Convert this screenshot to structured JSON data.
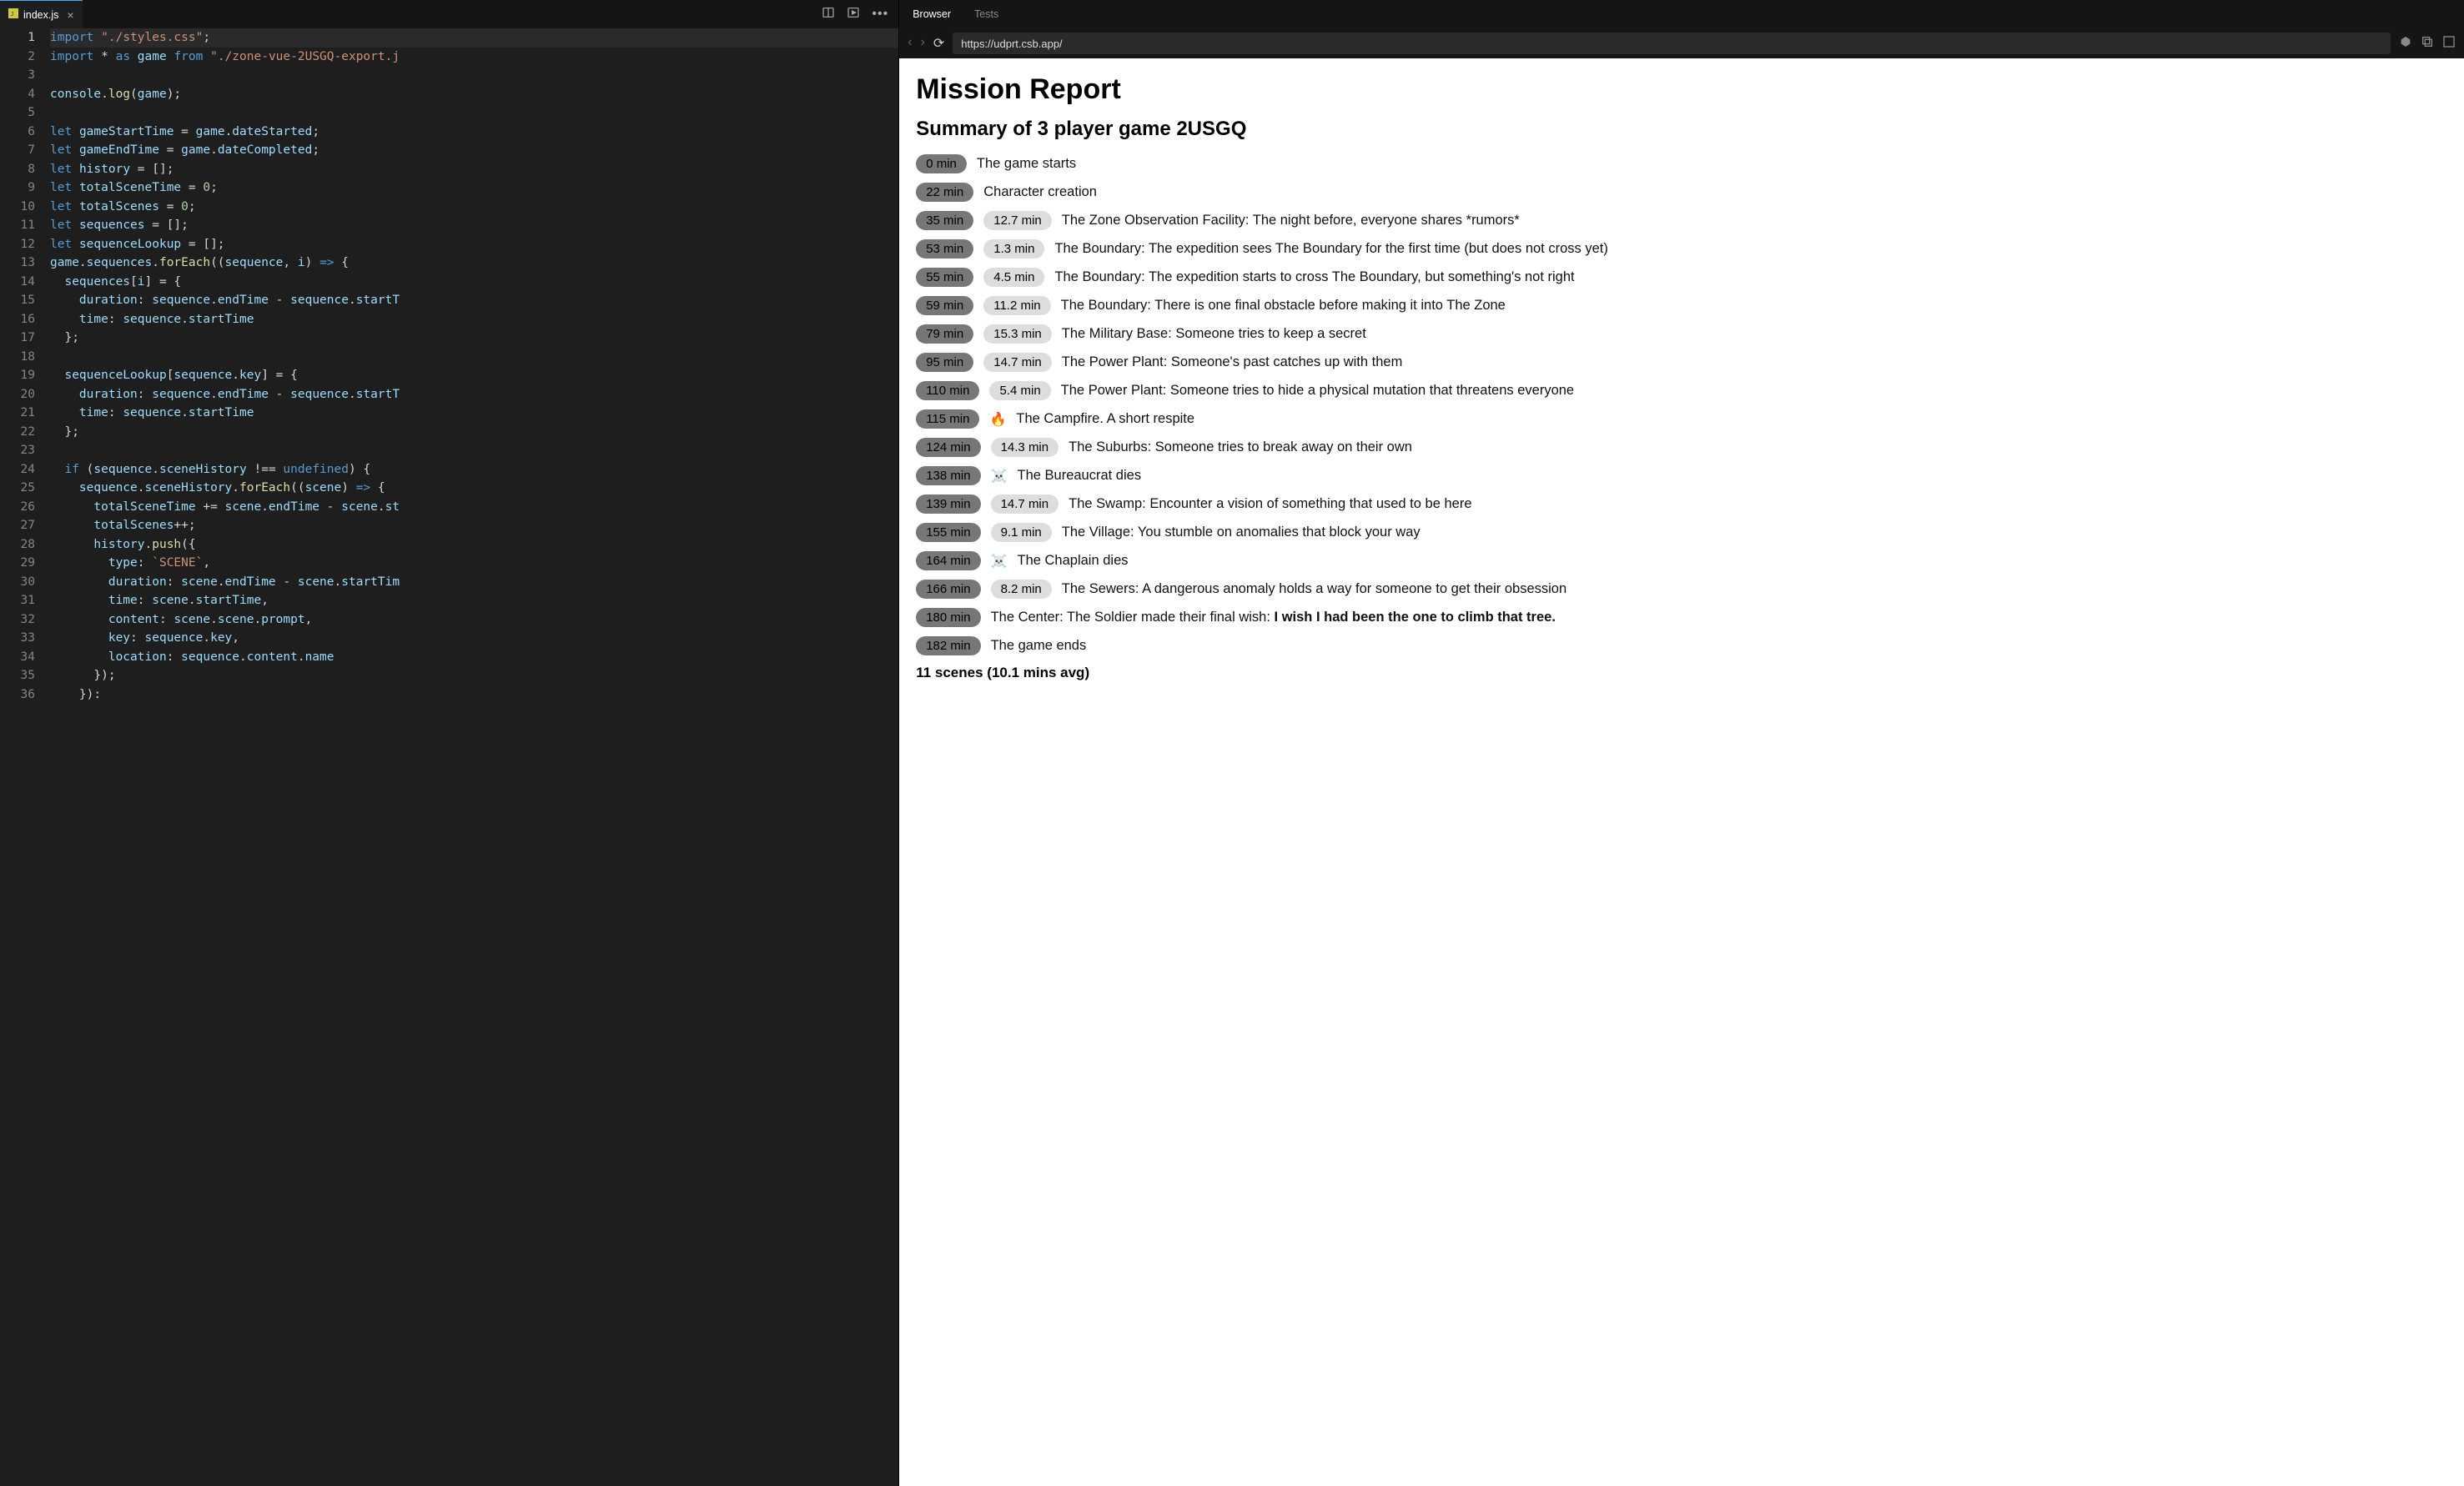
{
  "editor": {
    "tab": {
      "filename": "index.js"
    },
    "lines": [
      [
        [
          "tk-kw",
          "import"
        ],
        [
          "tk-punc",
          " "
        ],
        [
          "tk-str",
          "\"./styles.css\""
        ],
        [
          "tk-punc",
          ";"
        ]
      ],
      [
        [
          "tk-kw",
          "import"
        ],
        [
          "tk-punc",
          " "
        ],
        [
          "tk-op",
          "*"
        ],
        [
          "tk-punc",
          " "
        ],
        [
          "tk-kw",
          "as"
        ],
        [
          "tk-punc",
          " "
        ],
        [
          "tk-id",
          "game"
        ],
        [
          "tk-punc",
          " "
        ],
        [
          "tk-kw",
          "from"
        ],
        [
          "tk-punc",
          " "
        ],
        [
          "tk-str",
          "\"./zone-vue-2USGQ-export.j"
        ]
      ],
      [],
      [
        [
          "tk-id",
          "console"
        ],
        [
          "tk-punc",
          "."
        ],
        [
          "tk-fn",
          "log"
        ],
        [
          "tk-punc",
          "("
        ],
        [
          "tk-id",
          "game"
        ],
        [
          "tk-punc",
          ");"
        ]
      ],
      [],
      [
        [
          "tk-kw",
          "let"
        ],
        [
          "tk-punc",
          " "
        ],
        [
          "tk-id",
          "gameStartTime"
        ],
        [
          "tk-punc",
          " = "
        ],
        [
          "tk-id",
          "game"
        ],
        [
          "tk-punc",
          "."
        ],
        [
          "tk-prop",
          "dateStarted"
        ],
        [
          "tk-punc",
          ";"
        ]
      ],
      [
        [
          "tk-kw",
          "let"
        ],
        [
          "tk-punc",
          " "
        ],
        [
          "tk-id",
          "gameEndTime"
        ],
        [
          "tk-punc",
          " = "
        ],
        [
          "tk-id",
          "game"
        ],
        [
          "tk-punc",
          "."
        ],
        [
          "tk-prop",
          "dateCompleted"
        ],
        [
          "tk-punc",
          ";"
        ]
      ],
      [
        [
          "tk-kw",
          "let"
        ],
        [
          "tk-punc",
          " "
        ],
        [
          "tk-id",
          "history"
        ],
        [
          "tk-punc",
          " = [];"
        ]
      ],
      [
        [
          "tk-kw",
          "let"
        ],
        [
          "tk-punc",
          " "
        ],
        [
          "tk-id",
          "totalSceneTime"
        ],
        [
          "tk-punc",
          " = "
        ],
        [
          "tk-num",
          "0"
        ],
        [
          "tk-punc",
          ";"
        ]
      ],
      [
        [
          "tk-kw",
          "let"
        ],
        [
          "tk-punc",
          " "
        ],
        [
          "tk-id",
          "totalScenes"
        ],
        [
          "tk-punc",
          " = "
        ],
        [
          "tk-num",
          "0"
        ],
        [
          "tk-punc",
          ";"
        ]
      ],
      [
        [
          "tk-kw",
          "let"
        ],
        [
          "tk-punc",
          " "
        ],
        [
          "tk-id",
          "sequences"
        ],
        [
          "tk-punc",
          " = [];"
        ]
      ],
      [
        [
          "tk-kw",
          "let"
        ],
        [
          "tk-punc",
          " "
        ],
        [
          "tk-id",
          "sequenceLookup"
        ],
        [
          "tk-punc",
          " = [];"
        ]
      ],
      [
        [
          "tk-id",
          "game"
        ],
        [
          "tk-punc",
          "."
        ],
        [
          "tk-prop",
          "sequences"
        ],
        [
          "tk-punc",
          "."
        ],
        [
          "tk-fn",
          "forEach"
        ],
        [
          "tk-punc",
          "(("
        ],
        [
          "tk-id",
          "sequence"
        ],
        [
          "tk-punc",
          ", "
        ],
        [
          "tk-id",
          "i"
        ],
        [
          "tk-punc",
          ") "
        ],
        [
          "tk-kw",
          "=>"
        ],
        [
          "tk-punc",
          " {"
        ]
      ],
      [
        [
          "tk-punc",
          "  "
        ],
        [
          "tk-id",
          "sequences"
        ],
        [
          "tk-punc",
          "["
        ],
        [
          "tk-id",
          "i"
        ],
        [
          "tk-punc",
          "] = {"
        ]
      ],
      [
        [
          "tk-punc",
          "    "
        ],
        [
          "tk-prop",
          "duration"
        ],
        [
          "tk-punc",
          ": "
        ],
        [
          "tk-id",
          "sequence"
        ],
        [
          "tk-punc",
          "."
        ],
        [
          "tk-prop",
          "endTime"
        ],
        [
          "tk-punc",
          " - "
        ],
        [
          "tk-id",
          "sequence"
        ],
        [
          "tk-punc",
          "."
        ],
        [
          "tk-prop",
          "startT"
        ]
      ],
      [
        [
          "tk-punc",
          "    "
        ],
        [
          "tk-prop",
          "time"
        ],
        [
          "tk-punc",
          ": "
        ],
        [
          "tk-id",
          "sequence"
        ],
        [
          "tk-punc",
          "."
        ],
        [
          "tk-prop",
          "startTime"
        ]
      ],
      [
        [
          "tk-punc",
          "  };"
        ]
      ],
      [],
      [
        [
          "tk-punc",
          "  "
        ],
        [
          "tk-id",
          "sequenceLookup"
        ],
        [
          "tk-punc",
          "["
        ],
        [
          "tk-id",
          "sequence"
        ],
        [
          "tk-punc",
          "."
        ],
        [
          "tk-prop",
          "key"
        ],
        [
          "tk-punc",
          "] = {"
        ]
      ],
      [
        [
          "tk-punc",
          "    "
        ],
        [
          "tk-prop",
          "duration"
        ],
        [
          "tk-punc",
          ": "
        ],
        [
          "tk-id",
          "sequence"
        ],
        [
          "tk-punc",
          "."
        ],
        [
          "tk-prop",
          "endTime"
        ],
        [
          "tk-punc",
          " - "
        ],
        [
          "tk-id",
          "sequence"
        ],
        [
          "tk-punc",
          "."
        ],
        [
          "tk-prop",
          "startT"
        ]
      ],
      [
        [
          "tk-punc",
          "    "
        ],
        [
          "tk-prop",
          "time"
        ],
        [
          "tk-punc",
          ": "
        ],
        [
          "tk-id",
          "sequence"
        ],
        [
          "tk-punc",
          "."
        ],
        [
          "tk-prop",
          "startTime"
        ]
      ],
      [
        [
          "tk-punc",
          "  };"
        ]
      ],
      [],
      [
        [
          "tk-punc",
          "  "
        ],
        [
          "tk-kw",
          "if"
        ],
        [
          "tk-punc",
          " ("
        ],
        [
          "tk-id",
          "sequence"
        ],
        [
          "tk-punc",
          "."
        ],
        [
          "tk-prop",
          "sceneHistory"
        ],
        [
          "tk-punc",
          " !== "
        ],
        [
          "tk-const",
          "undefined"
        ],
        [
          "tk-punc",
          ") {"
        ]
      ],
      [
        [
          "tk-punc",
          "    "
        ],
        [
          "tk-id",
          "sequence"
        ],
        [
          "tk-punc",
          "."
        ],
        [
          "tk-prop",
          "sceneHistory"
        ],
        [
          "tk-punc",
          "."
        ],
        [
          "tk-fn",
          "forEach"
        ],
        [
          "tk-punc",
          "(("
        ],
        [
          "tk-id",
          "scene"
        ],
        [
          "tk-punc",
          ") "
        ],
        [
          "tk-kw",
          "=>"
        ],
        [
          "tk-punc",
          " {"
        ]
      ],
      [
        [
          "tk-punc",
          "      "
        ],
        [
          "tk-id",
          "totalSceneTime"
        ],
        [
          "tk-punc",
          " += "
        ],
        [
          "tk-id",
          "scene"
        ],
        [
          "tk-punc",
          "."
        ],
        [
          "tk-prop",
          "endTime"
        ],
        [
          "tk-punc",
          " - "
        ],
        [
          "tk-id",
          "scene"
        ],
        [
          "tk-punc",
          "."
        ],
        [
          "tk-prop",
          "st"
        ]
      ],
      [
        [
          "tk-punc",
          "      "
        ],
        [
          "tk-id",
          "totalScenes"
        ],
        [
          "tk-punc",
          "++;"
        ]
      ],
      [
        [
          "tk-punc",
          "      "
        ],
        [
          "tk-id",
          "history"
        ],
        [
          "tk-punc",
          "."
        ],
        [
          "tk-fn",
          "push"
        ],
        [
          "tk-punc",
          "({"
        ]
      ],
      [
        [
          "tk-punc",
          "        "
        ],
        [
          "tk-prop",
          "type"
        ],
        [
          "tk-punc",
          ": "
        ],
        [
          "tk-str",
          "`SCENE`"
        ],
        [
          "tk-punc",
          ","
        ]
      ],
      [
        [
          "tk-punc",
          "        "
        ],
        [
          "tk-prop",
          "duration"
        ],
        [
          "tk-punc",
          ": "
        ],
        [
          "tk-id",
          "scene"
        ],
        [
          "tk-punc",
          "."
        ],
        [
          "tk-prop",
          "endTime"
        ],
        [
          "tk-punc",
          " - "
        ],
        [
          "tk-id",
          "scene"
        ],
        [
          "tk-punc",
          "."
        ],
        [
          "tk-prop",
          "startTim"
        ]
      ],
      [
        [
          "tk-punc",
          "        "
        ],
        [
          "tk-prop",
          "time"
        ],
        [
          "tk-punc",
          ": "
        ],
        [
          "tk-id",
          "scene"
        ],
        [
          "tk-punc",
          "."
        ],
        [
          "tk-prop",
          "startTime"
        ],
        [
          "tk-punc",
          ","
        ]
      ],
      [
        [
          "tk-punc",
          "        "
        ],
        [
          "tk-prop",
          "content"
        ],
        [
          "tk-punc",
          ": "
        ],
        [
          "tk-id",
          "scene"
        ],
        [
          "tk-punc",
          "."
        ],
        [
          "tk-prop",
          "scene"
        ],
        [
          "tk-punc",
          "."
        ],
        [
          "tk-prop",
          "prompt"
        ],
        [
          "tk-punc",
          ","
        ]
      ],
      [
        [
          "tk-punc",
          "        "
        ],
        [
          "tk-prop",
          "key"
        ],
        [
          "tk-punc",
          ": "
        ],
        [
          "tk-id",
          "sequence"
        ],
        [
          "tk-punc",
          "."
        ],
        [
          "tk-prop",
          "key"
        ],
        [
          "tk-punc",
          ","
        ]
      ],
      [
        [
          "tk-punc",
          "        "
        ],
        [
          "tk-prop",
          "location"
        ],
        [
          "tk-punc",
          ": "
        ],
        [
          "tk-id",
          "sequence"
        ],
        [
          "tk-punc",
          "."
        ],
        [
          "tk-prop",
          "content"
        ],
        [
          "tk-punc",
          "."
        ],
        [
          "tk-prop",
          "name"
        ]
      ],
      [
        [
          "tk-punc",
          "      });"
        ]
      ],
      [
        [
          "tk-punc",
          "    }):"
        ]
      ]
    ],
    "active_line": 1
  },
  "preview": {
    "tabs": {
      "browser": "Browser",
      "tests": "Tests",
      "active": "browser"
    },
    "url": "https://udprt.csb.app/",
    "page": {
      "title": "Mission Report",
      "subtitle": "Summary of 3 player game 2USGQ",
      "rows": [
        {
          "time": "0 min",
          "text": "The game starts"
        },
        {
          "time": "22 min",
          "text": "Character creation"
        },
        {
          "time": "35 min",
          "dur": "12.7 min",
          "text": "The Zone Observation Facility: The night before, everyone shares *rumors*"
        },
        {
          "time": "53 min",
          "dur": "1.3 min",
          "text": "The Boundary: The expedition sees The Boundary for the first time (but does not cross yet)"
        },
        {
          "time": "55 min",
          "dur": "4.5 min",
          "text": "The Boundary: The expedition starts to cross The Boundary, but something's not right"
        },
        {
          "time": "59 min",
          "dur": "11.2 min",
          "text": "The Boundary: There is one final obstacle before making it into The Zone"
        },
        {
          "time": "79 min",
          "dur": "15.3 min",
          "text": "The Military Base: Someone tries to keep a secret"
        },
        {
          "time": "95 min",
          "dur": "14.7 min",
          "text": "The Power Plant: Someone's past catches up with them"
        },
        {
          "time": "110 min",
          "dur": "5.4 min",
          "text": "The Power Plant: Someone tries to hide a physical mutation that threatens everyone"
        },
        {
          "time": "115 min",
          "emoji": "🔥",
          "text": "The Campfire. A short respite"
        },
        {
          "time": "124 min",
          "dur": "14.3 min",
          "text": "The Suburbs: Someone tries to break away on their own"
        },
        {
          "time": "138 min",
          "emoji": "☠️",
          "text": "The Bureaucrat dies"
        },
        {
          "time": "139 min",
          "dur": "14.7 min",
          "text": "The Swamp: Encounter a vision of something that used to be here"
        },
        {
          "time": "155 min",
          "dur": "9.1 min",
          "text": "The Village: You stumble on anomalies that block your way"
        },
        {
          "time": "164 min",
          "emoji": "☠️",
          "text": "The Chaplain dies"
        },
        {
          "time": "166 min",
          "dur": "8.2 min",
          "text": "The Sewers: A dangerous anomaly holds a way for someone to get their obsession"
        },
        {
          "time": "180 min",
          "text_pre": "The Center: The Soldier made their final wish: ",
          "text_bold": "I wish I had been the one to climb that tree."
        },
        {
          "time": "182 min",
          "text": "The game ends"
        }
      ],
      "footer": "11 scenes (10.1 mins avg)"
    }
  }
}
